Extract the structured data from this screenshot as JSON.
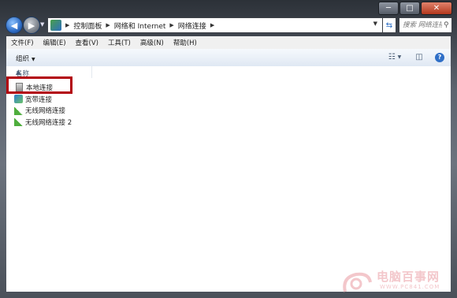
{
  "window": {
    "caption_buttons": {
      "minimize": "─",
      "maximize": "□",
      "close": "✕"
    }
  },
  "nav": {
    "back_glyph": "◀",
    "forward_glyph": "▶",
    "breadcrumbs": [
      "控制面板",
      "网络和 Internet",
      "网络连接"
    ],
    "search_placeholder": "搜索 网络连接"
  },
  "menubar": {
    "items": [
      "文件(F)",
      "编辑(E)",
      "查看(V)",
      "工具(T)",
      "高级(N)",
      "帮助(H)"
    ]
  },
  "command_bar": {
    "organize": "组织"
  },
  "list": {
    "column_name": "名称",
    "items": [
      {
        "label": "本地连接",
        "icon": "wired-nic"
      },
      {
        "label": "宽带连接",
        "icon": "broadband"
      },
      {
        "label": "无线网络连接",
        "icon": "wireless"
      },
      {
        "label": "无线网络连接 2",
        "icon": "wireless"
      }
    ]
  },
  "highlight": {
    "color": "#b2000b"
  },
  "watermark": {
    "title": "电脑百事网",
    "subtitle": "WWW.PC841.COM"
  }
}
